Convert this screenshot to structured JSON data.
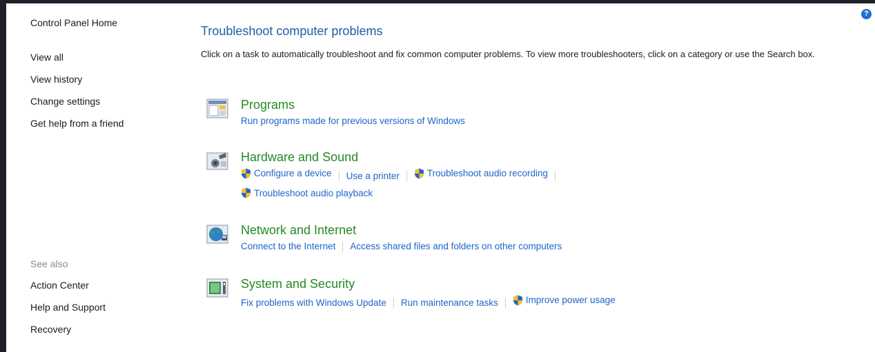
{
  "sidebar": {
    "home": "Control Panel Home",
    "links": [
      "View all",
      "View history",
      "Change settings",
      "Get help from a friend"
    ],
    "see_also_title": "See also",
    "see_also": [
      "Action Center",
      "Help and Support",
      "Recovery"
    ]
  },
  "main": {
    "title": "Troubleshoot computer problems",
    "description": "Click on a task to automatically troubleshoot and fix common computer problems. To view more troubleshooters, click on a category or use the Search box.",
    "categories": [
      {
        "title": "Programs",
        "icon": "programs-icon",
        "tasks": [
          "Run programs made for previous versions of Windows"
        ]
      },
      {
        "title": "Hardware and Sound",
        "icon": "hardware-sound-icon",
        "tasks": [
          "Configure a device",
          "Use a printer",
          "Troubleshoot audio recording",
          "Troubleshoot audio playback"
        ]
      },
      {
        "title": "Network and Internet",
        "icon": "network-globe-icon",
        "tasks": [
          "Connect to the Internet",
          "Access shared files and folders on other computers"
        ]
      },
      {
        "title": "System and Security",
        "icon": "system-security-icon",
        "tasks": [
          "Fix problems with Windows Update",
          "Run maintenance tasks",
          "Improve power usage"
        ]
      }
    ]
  },
  "help": {
    "glyph": "?"
  },
  "colors": {
    "link": "#1e64c8",
    "category_title": "#238a23",
    "page_title": "#1a5ea8",
    "frame": "#1f1f2b"
  }
}
